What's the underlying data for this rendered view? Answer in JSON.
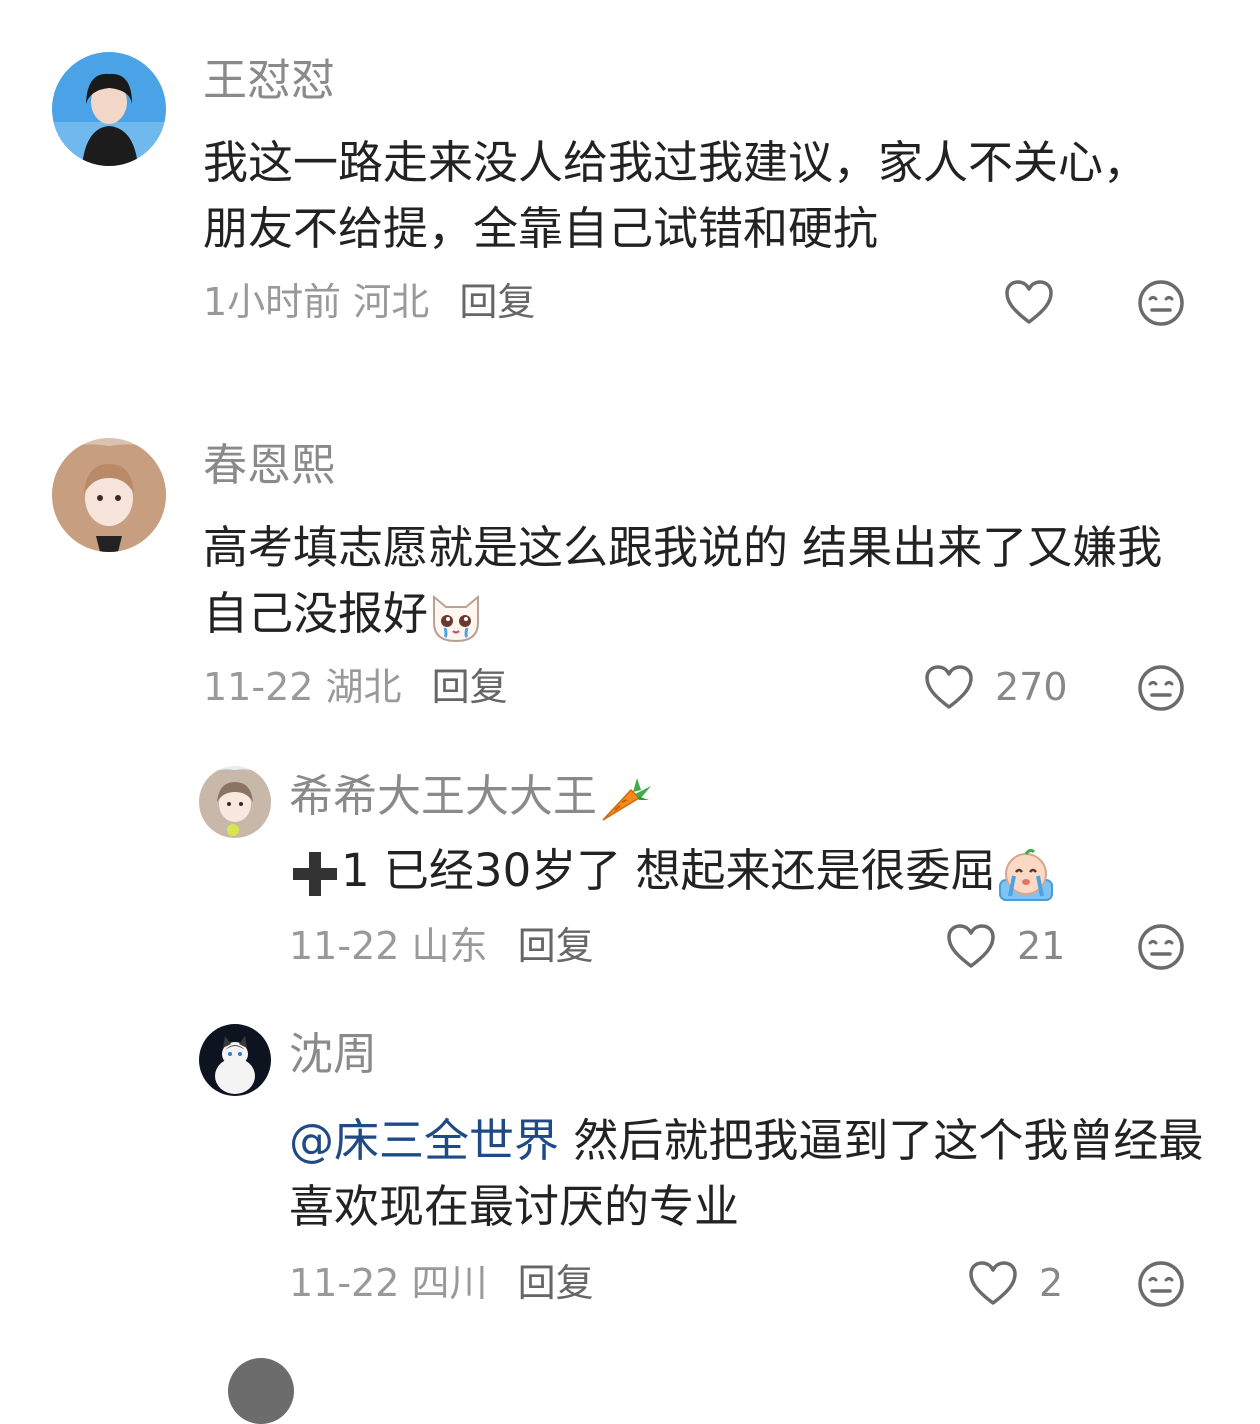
{
  "comments": [
    {
      "username": "王怼怼",
      "text": "我这一路走来没人给我过我建议，家人不关心，朋友不给提，全靠自己试错和硬抗",
      "time": "1小时前",
      "location": "河北",
      "reply_label": "回复",
      "like_count": ""
    },
    {
      "username": "春恩熙",
      "text": "高考填志愿就是这么跟我说的 结果出来了又嫌我自己没报好",
      "time": "11-22",
      "location": "湖北",
      "reply_label": "回复",
      "like_count": "270"
    },
    {
      "username": "希希大王大大王",
      "text_before": "1 已经30岁了 想起来还是很委屈",
      "time": "11-22",
      "location": "山东",
      "reply_label": "回复",
      "like_count": "21"
    },
    {
      "username": "沈周",
      "mention": "@床三全世界",
      "text": " 然后就把我逼到了这个我曾经最喜欢现在最讨厌的专业",
      "time": "11-22",
      "location": "四川",
      "reply_label": "回复",
      "like_count": "2"
    }
  ],
  "colors": {
    "username": "#8a8a8a",
    "body": "#222222",
    "meta": "#999999",
    "mention": "#1f4a86",
    "icon": "#6b6b6b"
  },
  "icons": {
    "like": "heart-outline-icon",
    "dislike": "neutral-face-icon"
  }
}
